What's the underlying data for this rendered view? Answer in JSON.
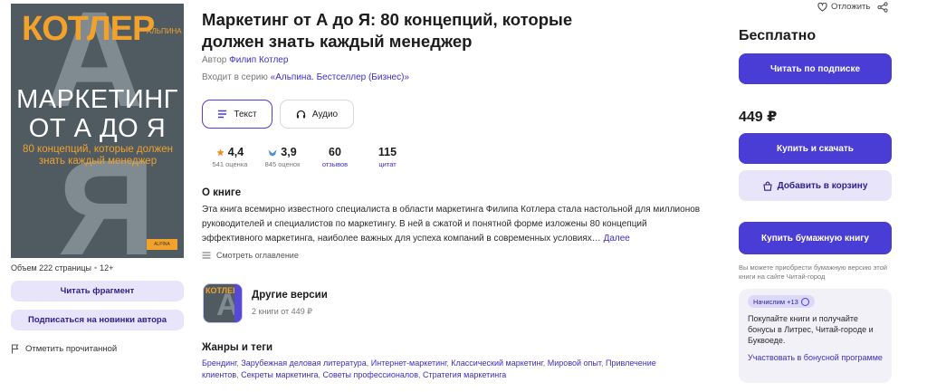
{
  "book": {
    "title": "Маркетинг от А до Я: 80 концепций, которые должен знать каждый менеджер",
    "author_prefix": "Автор",
    "author": "Филип Котлер",
    "series_prefix": "Входит в серию",
    "series": "«Альпина. Бестселлер (Бизнес)»"
  },
  "cover": {
    "author": "КОТЛЕР",
    "publisher_small": "АЛЬПИНА",
    "title_line1": "МАРКЕТИНГ",
    "title_line2": "ОТ А ДО Я",
    "subtitle": "80 концепций, которые должен знать каждый менеджер",
    "letter_a": "А",
    "letter_ya": "Я",
    "logo_text": "ALPINA"
  },
  "left": {
    "meta_volume": "Объем 222 страницы",
    "meta_age": "12+",
    "read_fragment": "Читать фрагмент",
    "subscribe_author": "Подписаться на новинки автора",
    "mark_read": "Отметить прочитанной"
  },
  "formats": {
    "text": "Текст",
    "audio": "Аудио"
  },
  "stats": {
    "rating_value": "4,4",
    "rating_label": "541 оценка",
    "rating2_value": "3,9",
    "rating2_label": "845 оценок",
    "reviews_value": "60",
    "reviews_label": "отзывов",
    "quotes_value": "115",
    "quotes_label": "цитат"
  },
  "about": {
    "heading": "О книге",
    "text": "Эта книга всемирно известного специалиста в области маркетинга Филипа Котлера стала настольной для миллионов руководителей и специалистов по маркетингу. В ней в сжатой и понятной форме изложены 80 концепций эффективного маркетинга, наиболее важных для успеха компаний в современных условиях…",
    "more": "Далее",
    "toc": "Смотреть оглавление"
  },
  "versions": {
    "title": "Другие версии",
    "subtitle": "2 книги от 449 ₽",
    "thumb_author": "КОТЛЕР",
    "thumb_letter": "А"
  },
  "genres": {
    "heading": "Жанры и теги",
    "items": [
      "Брендинг",
      "Зарубежная деловая литература",
      "Интернет-маркетинг",
      "Классический маркетинг",
      "Мировой опыт",
      "Привлечение клиентов",
      "Секреты маркетинга",
      "Советы профессионалов",
      "Стратегия маркетинга"
    ]
  },
  "right": {
    "postpone": "Отложить",
    "free": "Бесплатно",
    "read_subscription": "Читать по подписке",
    "price": "449 ₽",
    "buy_download": "Купить и скачать",
    "add_cart": "Добавить в корзину",
    "buy_paper": "Купить бумажную книгу",
    "paper_note": "Вы можете приобрести бумажную версию этой книги на сайте Читай-город",
    "bonus_badge": "Начислим +13",
    "bonus_text": "Покупайте книги и получайте бонусы в Литрес, Читай-городе и Буквоеде.",
    "bonus_link": "Участвовать в бонусной программе"
  },
  "colors": {
    "accent": "#4a3dd5",
    "accent_light": "#e8e5fb",
    "link": "#3d2ec4",
    "cover_bg": "#4f5a61",
    "cover_orange": "#f2a22b",
    "star": "#f28c28"
  }
}
